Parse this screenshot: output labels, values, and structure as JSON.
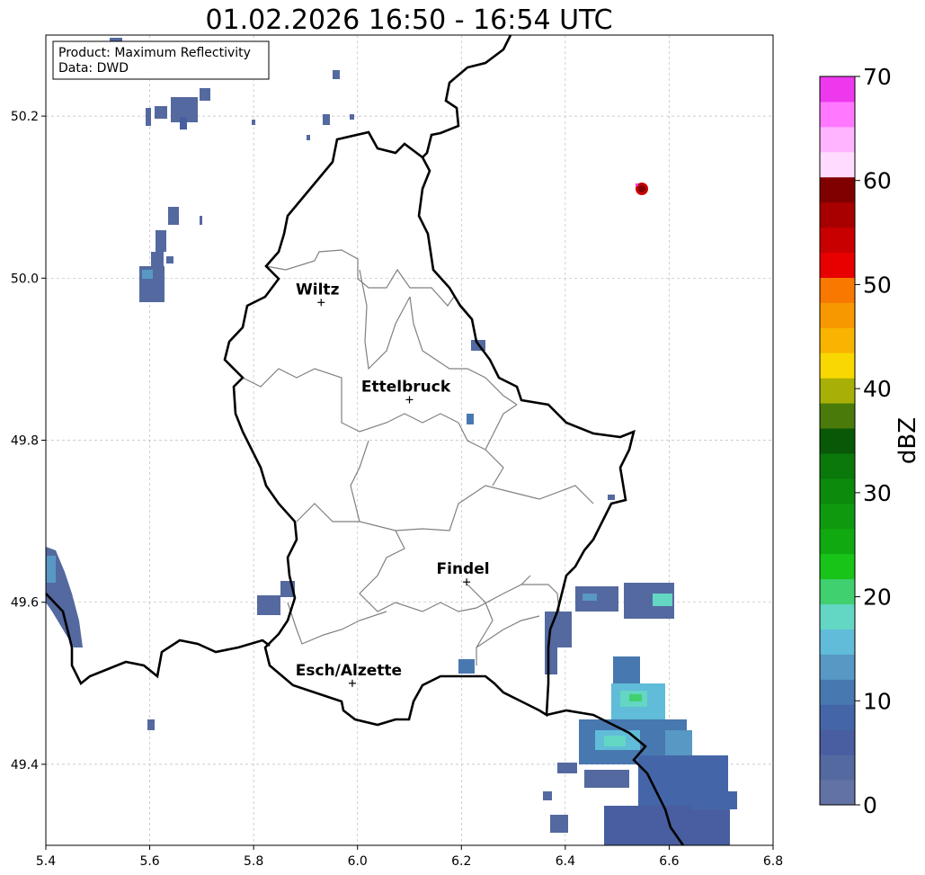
{
  "title": "01.02.2026 16:50 - 16:54 UTC",
  "info_box": {
    "product": "Product: Maximum Reflectivity",
    "source": "Data: DWD"
  },
  "map": {
    "lon_range": [
      5.4,
      6.8
    ],
    "lat_range": [
      49.3,
      50.3
    ],
    "x_ticks": [
      "5.4",
      "5.6",
      "5.8",
      "6.0",
      "6.2",
      "6.4",
      "6.6",
      "6.8"
    ],
    "y_ticks": [
      "49.4",
      "49.6",
      "49.8",
      "50.0",
      "50.2"
    ],
    "grid": "dashed"
  },
  "cities": [
    {
      "name": "Wiltz",
      "lon": 5.93,
      "lat": 49.97
    },
    {
      "name": "Ettelbruck",
      "lon": 6.1,
      "lat": 49.85
    },
    {
      "name": "Findel",
      "lon": 6.21,
      "lat": 49.625
    },
    {
      "name": "Esch/Alzette",
      "lon": 5.99,
      "lat": 49.5
    }
  ],
  "colorbar": {
    "label": "dBZ",
    "min": 0,
    "max": 70,
    "tick_labels": [
      "0",
      "10",
      "20",
      "30",
      "40",
      "50",
      "60",
      "70"
    ],
    "colors": [
      "#6272a4",
      "#54699f",
      "#485ea0",
      "#4466a8",
      "#4878b0",
      "#5898c4",
      "#60bcd8",
      "#64d6c4",
      "#40d070",
      "#18c418",
      "#10aa10",
      "#0e9a0e",
      "#0c8a0c",
      "#0a780a",
      "#085808",
      "#4a7a0a",
      "#a8b008",
      "#f8d800",
      "#f8b400",
      "#f89800",
      "#f87800",
      "#e80000",
      "#c80000",
      "#a80000",
      "#800000",
      "#ffdcff",
      "#ffb4ff",
      "#ff78ff",
      "#ee38ee"
    ]
  }
}
